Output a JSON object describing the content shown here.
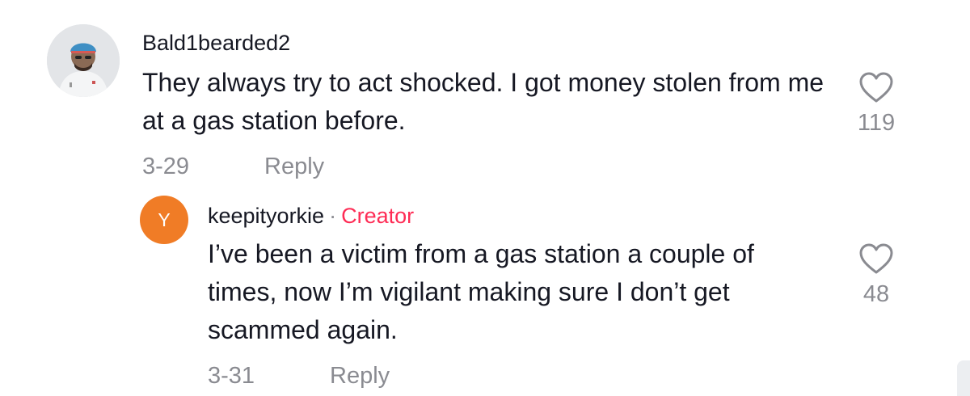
{
  "comments": [
    {
      "username": "Bald1bearded2",
      "text": "They always try to act shocked. I got money stolen from me at a gas station before.",
      "date": "3-29",
      "reply_label": "Reply",
      "like_count": "119",
      "avatar_icon": "user-photo"
    }
  ],
  "replies": [
    {
      "avatar_letter": "Y",
      "avatar_color": "#f07c26",
      "username": "keepityorkie",
      "separator": "·",
      "badge": "Creator",
      "badge_color": "#fe2c55",
      "text": "I’ve been a victim from a gas station a couple of times, now I’m vigilant making sure I don’t get scammed again.",
      "date": "3-31",
      "reply_label": "Reply",
      "like_count": "48"
    }
  ]
}
